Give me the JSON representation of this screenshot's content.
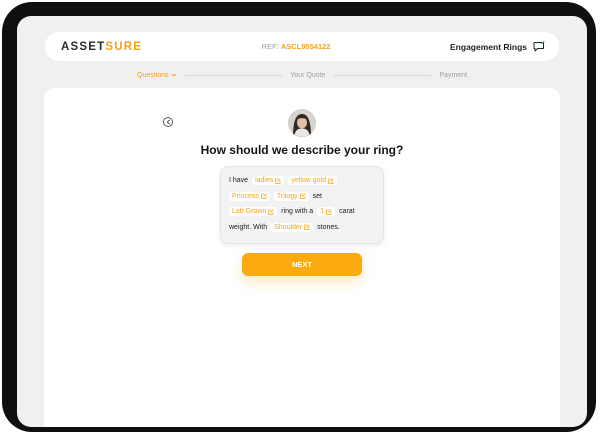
{
  "brand": {
    "part1": "ASSET",
    "part2": "SURE",
    "accent_color": "#f5a218"
  },
  "header": {
    "ref_label": "REF:",
    "ref_value": "ASCL9554122",
    "product": "Engagement Rings",
    "product_icon": "chat-edit-icon"
  },
  "steps": [
    {
      "label": "Questions",
      "active": true
    },
    {
      "label": "Your Quote",
      "active": false
    },
    {
      "label": "Payment",
      "active": false
    }
  ],
  "back_icon": "back-arrow-icon",
  "question": "How should we describe your ring?",
  "sentence": {
    "t1": "I have",
    "metal_type": "ladies",
    "metal": "yellow gold",
    "shape": "Princess",
    "style": "Trilogy",
    "t2": "set",
    "origin": "Lab Grown",
    "t3": "ring with a",
    "carat": "1",
    "t4": "carat",
    "t5": "weight. With",
    "setting": "Shoulder",
    "t6": "stones."
  },
  "next_label": "NEXT"
}
